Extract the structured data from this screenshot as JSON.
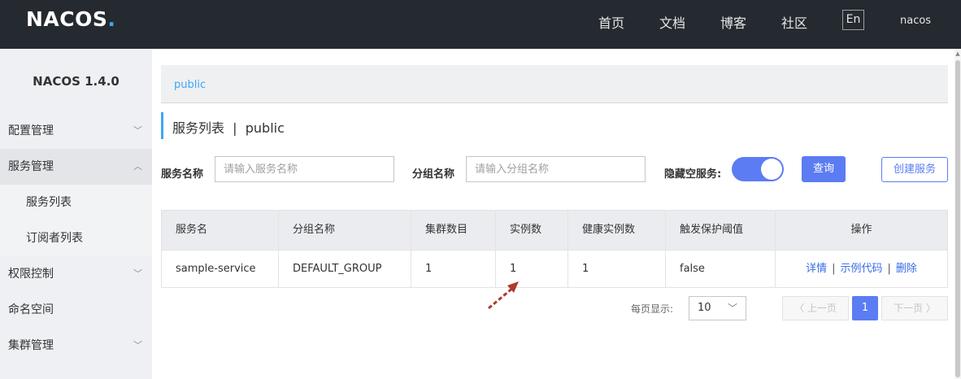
{
  "header": {
    "logo_main": "NACOS",
    "logo_dot": ".",
    "nav": [
      "首页",
      "文档",
      "博客",
      "社区"
    ],
    "lang_label": "En",
    "user_label": "nacos"
  },
  "sidebar": {
    "title": "NACOS 1.4.0",
    "items": [
      {
        "label": "配置管理",
        "arrow": "﹀"
      },
      {
        "label": "服务管理",
        "arrow": "︿"
      },
      {
        "label": "服务列表"
      },
      {
        "label": "订阅者列表"
      },
      {
        "label": "权限控制",
        "arrow": "﹀"
      },
      {
        "label": "命名空间"
      },
      {
        "label": "集群管理",
        "arrow": "﹀"
      }
    ]
  },
  "breadcrumb": "public",
  "page_title": "服务列表  |  public",
  "filters": {
    "service_name_label": "服务名称",
    "service_name_placeholder": "请输入服务名称",
    "group_name_label": "分组名称",
    "group_name_placeholder": "请输入分组名称",
    "hide_empty_label": "隐藏空服务:",
    "hide_empty_enabled": true,
    "query_label": "查询",
    "create_label": "创建服务"
  },
  "table": {
    "headers": [
      "服务名",
      "分组名称",
      "集群数目",
      "实例数",
      "健康实例数",
      "触发保护阈值",
      "操作"
    ],
    "rows": [
      {
        "service": "sample-service",
        "group": "DEFAULT_GROUP",
        "clusters": "1",
        "instances": "1",
        "healthy": "1",
        "threshold": "false",
        "actions": [
          "详情",
          "示例代码",
          "删除"
        ]
      }
    ]
  },
  "pagination": {
    "per_page_label": "每页显示:",
    "page_size": "10",
    "prev_label": "〈 上一页",
    "current_page": "1",
    "next_label": "下一页 〉"
  },
  "colors": {
    "topbar": "#252a30",
    "accent": "#5b7cf3",
    "link": "#3a6ce8",
    "breadcrumb": "#3fa7f5",
    "annotation": "#b03a2e"
  }
}
